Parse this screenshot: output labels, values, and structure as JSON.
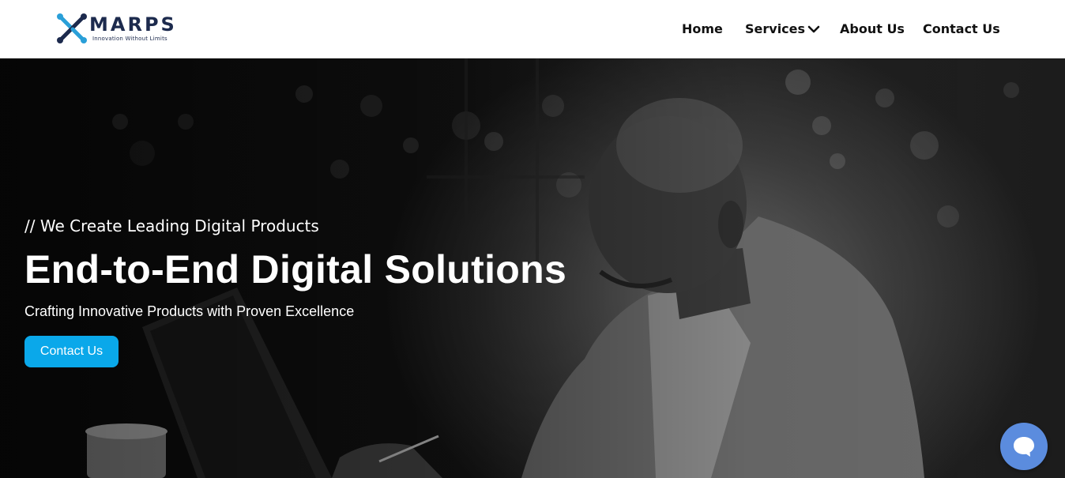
{
  "brand": {
    "name": "MARPS",
    "tagline": "Innovation Without Limits",
    "logo_icon": "x-cross-logo-icon",
    "colors": {
      "dark": "#1c2a4d",
      "accent": "#2a9fd8"
    }
  },
  "nav": {
    "items": [
      {
        "label": "Home"
      },
      {
        "label": "Services",
        "icon": "chevron-down-icon"
      },
      {
        "label": "About Us"
      },
      {
        "label": "Contact Us"
      }
    ]
  },
  "hero": {
    "eyebrow": "// We Create Leading Digital Products",
    "headline": "End-to-End Digital Solutions",
    "subhead": "Crafting Innovative Products with Proven Excellence",
    "cta_label": "Contact Us",
    "cta_color": "#0aa8ea",
    "background": "grayscale photo of man at laptop in cafe"
  },
  "chat": {
    "icon": "chat-bubble-icon",
    "color": "#5b8cde"
  }
}
